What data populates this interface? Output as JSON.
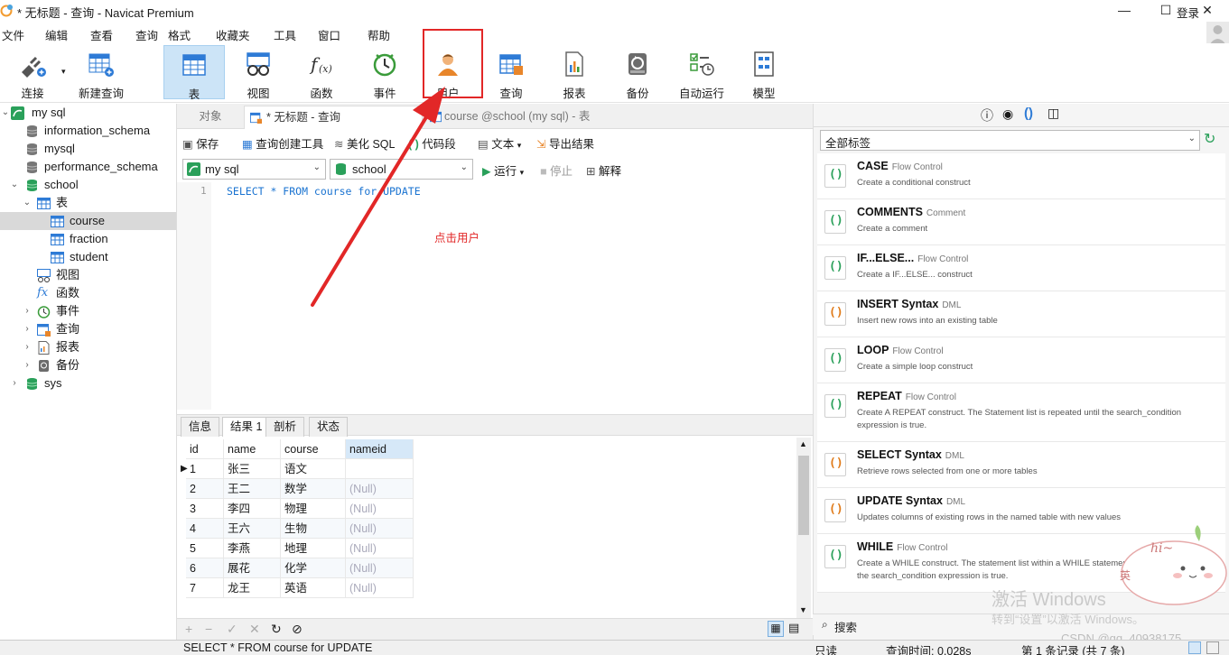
{
  "window": {
    "title": "* 无标题 - 查询 - Navicat Premium",
    "minimize": "—",
    "maximize": "☐",
    "close": "✕"
  },
  "menu": {
    "items": [
      "文件",
      "编辑",
      "查看",
      "查询",
      "格式",
      "收藏夹",
      "工具",
      "窗口",
      "帮助"
    ],
    "login": "登录"
  },
  "toolbar": {
    "items": [
      "连接",
      "新建查询",
      "表",
      "视图",
      "函数",
      "事件",
      "用户",
      "查询",
      "报表",
      "备份",
      "自动运行",
      "模型"
    ],
    "active": "表"
  },
  "annotation": {
    "text": "点击用户",
    "color": "#e22727"
  },
  "tree": {
    "connection": "my sql",
    "databases": [
      "information_schema",
      "mysql",
      "performance_schema",
      "school"
    ],
    "school_children": {
      "tables_label": "表",
      "tables": [
        "course",
        "fraction",
        "student"
      ],
      "selected_table": "course",
      "others": [
        "视图",
        "函数",
        "事件",
        "查询",
        "报表",
        "备份"
      ]
    },
    "sys": "sys"
  },
  "tabs": {
    "objects": "对象",
    "query": "* 无标题 - 查询",
    "course": "course @school (my sql) - 表"
  },
  "query_toolbar": {
    "save": "保存",
    "builder": "查询创建工具",
    "beautify": "美化 SQL",
    "snippet": "代码段",
    "text": "文本",
    "export": "导出结果"
  },
  "selectors": {
    "connection": "my sql",
    "database": "school",
    "run": "运行",
    "stop": "停止",
    "explain": "解释"
  },
  "editor": {
    "line": "1",
    "sql": "SELECT * FROM course for UPDATE"
  },
  "result_tabs": [
    "信息",
    "结果 1",
    "剖析",
    "状态"
  ],
  "result_active": "结果 1",
  "grid": {
    "columns": [
      "id",
      "name",
      "course",
      "nameid"
    ],
    "rows": [
      [
        "1",
        "张三",
        "语文",
        ""
      ],
      [
        "2",
        "王二",
        "数学",
        "(Null)"
      ],
      [
        "3",
        "李四",
        "物理",
        "(Null)"
      ],
      [
        "4",
        "王六",
        "生物",
        "(Null)"
      ],
      [
        "5",
        "李燕",
        "地理",
        "(Null)"
      ],
      [
        "6",
        "展花",
        "化学",
        "(Null)"
      ],
      [
        "7",
        "龙王",
        "英语",
        "(Null)"
      ]
    ]
  },
  "right_panel": {
    "filter": "全部标签",
    "snippets": [
      {
        "title": "CASE",
        "category": "Flow Control",
        "desc": "Create a conditional construct"
      },
      {
        "title": "COMMENTS",
        "category": "Comment",
        "desc": "Create a comment"
      },
      {
        "title": "IF...ELSE...",
        "category": "Flow Control",
        "desc": "Create a IF...ELSE... construct"
      },
      {
        "title": "INSERT Syntax",
        "category": "DML",
        "desc": "Insert new rows into an existing table"
      },
      {
        "title": "LOOP",
        "category": "Flow Control",
        "desc": "Create a simple loop construct"
      },
      {
        "title": "REPEAT",
        "category": "Flow Control",
        "desc": "Create A REPEAT construct. The Statement list is repeated until the search_condition expression is true."
      },
      {
        "title": "SELECT Syntax",
        "category": "DML",
        "desc": "Retrieve rows selected from one or more tables"
      },
      {
        "title": "UPDATE Syntax",
        "category": "DML",
        "desc": "Updates columns of existing rows in the named table with new values"
      },
      {
        "title": "WHILE",
        "category": "Flow Control",
        "desc": "Create a WHILE construct. The statement list within a WHILE statement is repeated as long as the search_condition expression is true."
      }
    ],
    "search": "搜索"
  },
  "watermark": {
    "line1": "激活 Windows",
    "line2": "转到“设置”以激活 Windows。",
    "csdn": "CSDN @qq_40938175"
  },
  "statusbar": {
    "sql": "SELECT * FROM course for UPDATE",
    "readonly": "只读",
    "query_time": "查询时间: 0.028s",
    "record": "第 1 条记录 (共 7 条)"
  }
}
